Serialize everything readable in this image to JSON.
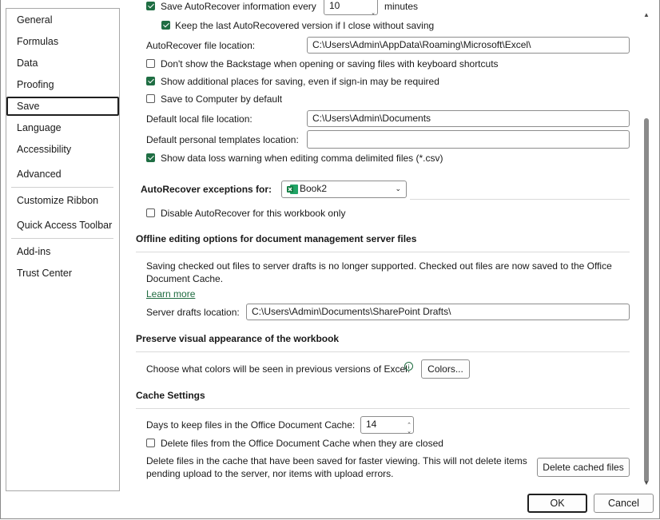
{
  "sidebar": {
    "items": [
      {
        "label": "General"
      },
      {
        "label": "Formulas"
      },
      {
        "label": "Data"
      },
      {
        "label": "Proofing"
      },
      {
        "label": "Save"
      },
      {
        "label": "Language"
      },
      {
        "label": "Accessibility"
      },
      {
        "label": "Advanced"
      },
      {
        "label": "Customize Ribbon"
      },
      {
        "label": "Quick Access Toolbar"
      },
      {
        "label": "Add-ins"
      },
      {
        "label": "Trust Center"
      }
    ],
    "selected": "Save"
  },
  "save_workbooks": {
    "autorecover_partial_label": "Save AutoRecover information every",
    "autorecover_minutes_value": "10",
    "minutes_label": "minutes",
    "keep_last_label": "Keep the last AutoRecovered version if I close without saving",
    "autorecover_location_label": "AutoRecover file location:",
    "autorecover_location_value": "C:\\Users\\Admin\\AppData\\Roaming\\Microsoft\\Excel\\",
    "dont_show_backstage_label": "Don't show the Backstage when opening or saving files with keyboard shortcuts",
    "show_additional_places_label": "Show additional places for saving, even if sign-in may be required",
    "save_to_computer_label": "Save to Computer by default",
    "default_local_label": "Default local file location:",
    "default_local_value": "C:\\Users\\Admin\\Documents",
    "default_templates_label": "Default personal templates location:",
    "default_templates_value": "",
    "data_loss_label": "Show data loss warning when editing comma delimited files (*.csv)"
  },
  "autorecover_exceptions": {
    "label": "AutoRecover exceptions for:",
    "workbook": "Book2",
    "disable_label": "Disable AutoRecover for this workbook only"
  },
  "offline": {
    "heading": "Offline editing options for document management server files",
    "description_line1": "Saving checked out files to server drafts is no longer supported. Checked out files are now saved to the Office",
    "description_line2": "Document Cache.",
    "learn_more": "Learn more",
    "server_drafts_label": "Server drafts location:",
    "server_drafts_value": "C:\\Users\\Admin\\Documents\\SharePoint Drafts\\"
  },
  "preserve": {
    "heading": "Preserve visual appearance of the workbook",
    "colors_label": "Choose what colors will be seen in previous versions of Excel:",
    "colors_button": "Colors..."
  },
  "cache": {
    "heading": "Cache Settings",
    "days_label": "Days to keep files in the Office Document Cache:",
    "days_value": "14",
    "delete_closed_label": "Delete files from the Office Document Cache when they are closed",
    "delete_desc_line1": "Delete files in the cache that have been saved for faster viewing. This will not delete items",
    "delete_desc_line2": "pending upload to the server, nor items with upload errors.",
    "delete_button": "Delete cached files"
  },
  "dialog": {
    "ok": "OK",
    "cancel": "Cancel"
  },
  "checkbox_states": {
    "save_autorecover": true,
    "keep_last": true,
    "dont_show_backstage": false,
    "show_additional_places": true,
    "save_to_computer": false,
    "data_loss": true,
    "disable_autorecover": false,
    "delete_closed": false
  },
  "colors": {
    "accent": "#1f6e43",
    "link": "#1e6b3f"
  }
}
